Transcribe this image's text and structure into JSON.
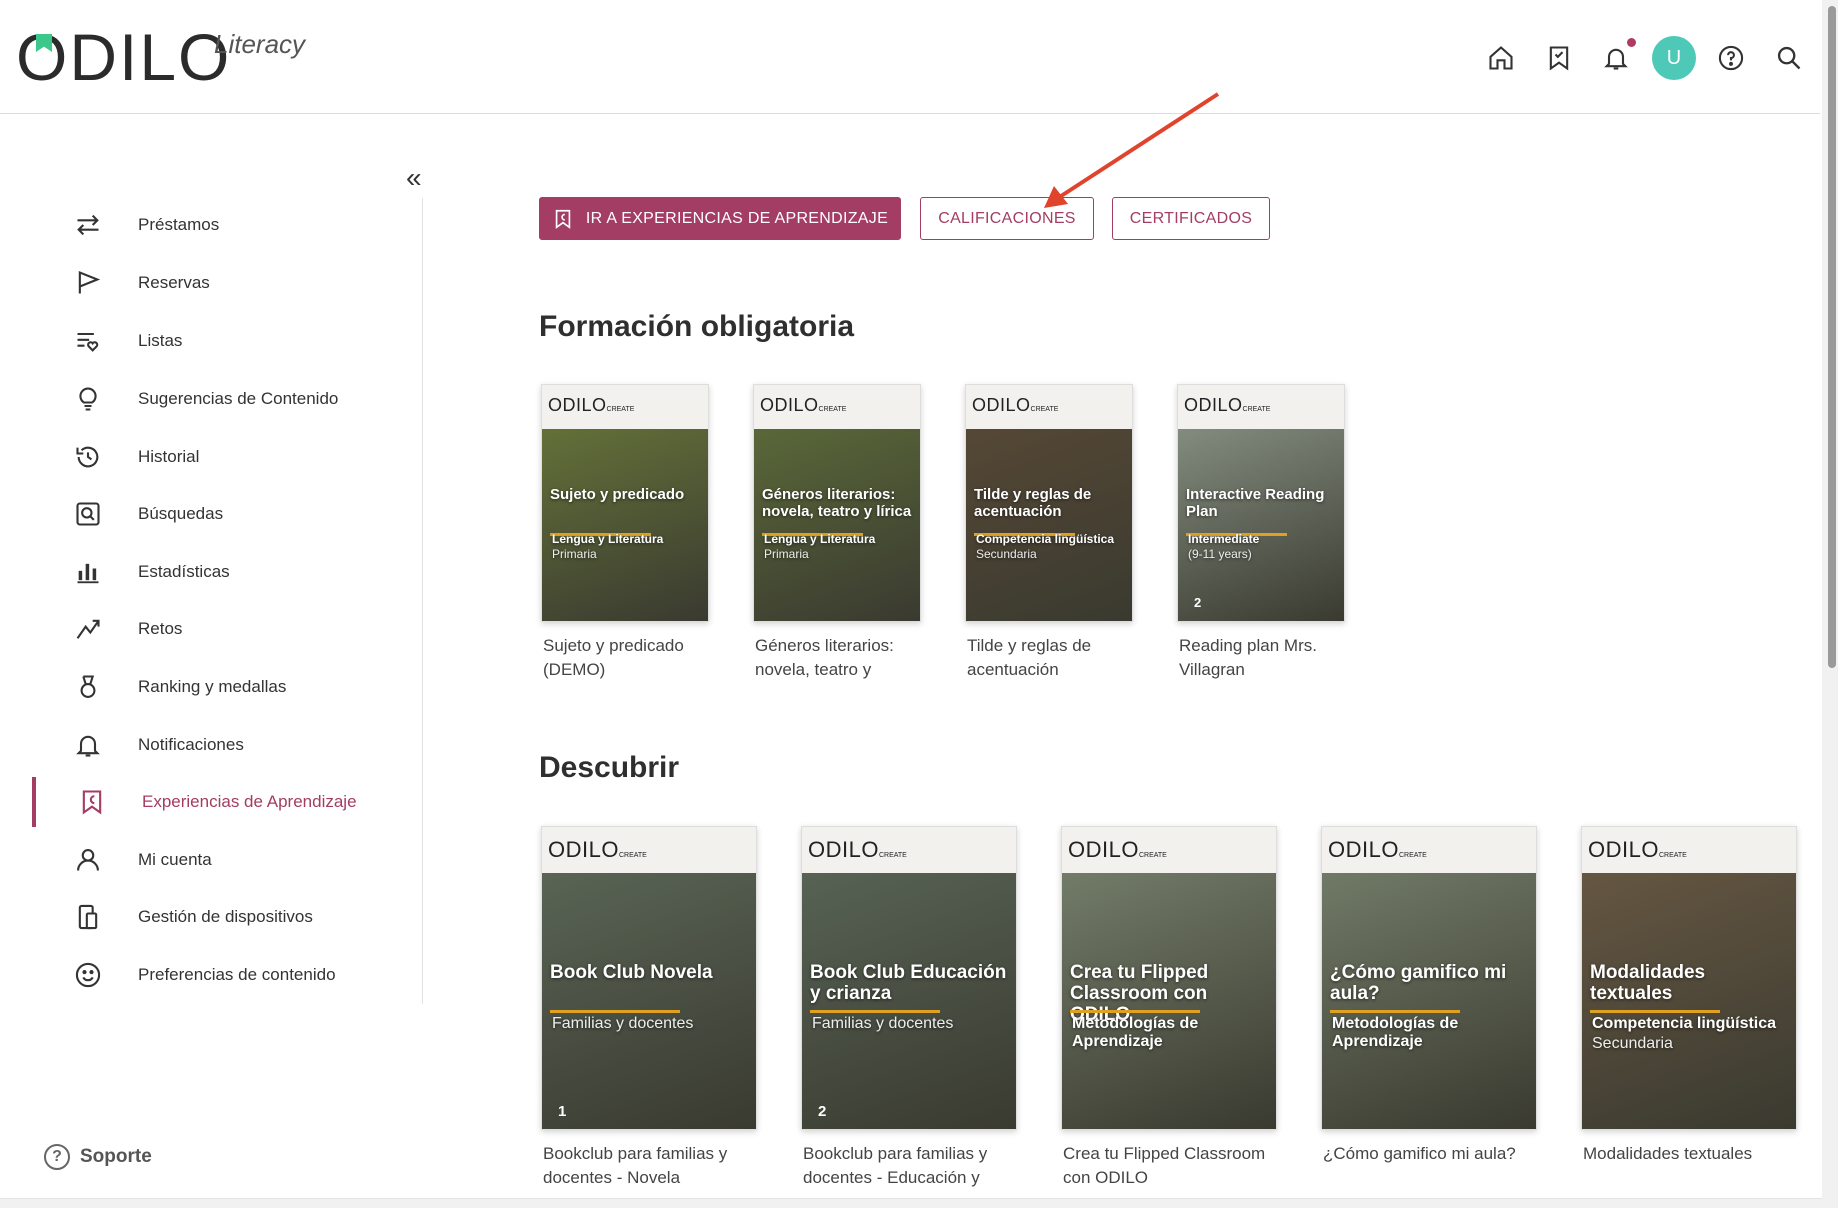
{
  "header": {
    "logo_text": "ODILO",
    "logo_sub": "Literacy",
    "avatar_letter": "U"
  },
  "sidebar": {
    "collapse": "«",
    "items": [
      {
        "label": "Préstamos",
        "icon": "swap-arrows-icon"
      },
      {
        "label": "Reservas",
        "icon": "flag-icon"
      },
      {
        "label": "Listas",
        "icon": "list-heart-icon"
      },
      {
        "label": "Sugerencias de Contenido",
        "icon": "lightbulb-icon"
      },
      {
        "label": "Historial",
        "icon": "history-icon"
      },
      {
        "label": "Búsquedas",
        "icon": "search-box-icon"
      },
      {
        "label": "Estadísticas",
        "icon": "bar-chart-icon"
      },
      {
        "label": "Retos",
        "icon": "challenge-icon"
      },
      {
        "label": "Ranking y medallas",
        "icon": "medal-icon"
      },
      {
        "label": "Notificaciones",
        "icon": "bell-icon"
      },
      {
        "label": "Experiencias de Aprendizaje",
        "icon": "learning-bookmark-icon"
      },
      {
        "label": "Mi cuenta",
        "icon": "user-icon"
      },
      {
        "label": "Gestión de dispositivos",
        "icon": "devices-icon"
      },
      {
        "label": "Preferencias de contenido",
        "icon": "smiley-icon"
      }
    ],
    "active_index": 10,
    "support": "Soporte",
    "support_icon": "?"
  },
  "actions": {
    "go_label": "IR A EXPERIENCIAS DE APRENDIZAJE",
    "grades_label": "CALIFICACIONES",
    "certs_label": "CERTIFICADOS"
  },
  "sections": {
    "mandatory": {
      "title": "Formación obligatoria",
      "cards": [
        {
          "cover_title": "Sujeto y predicado",
          "cover_subject": "Lengua y Literatura",
          "cover_level": "Primaria",
          "cover_num": "",
          "caption1": "Sujeto y predicado",
          "caption2": "(DEMO)",
          "bg": "#6a7a3a"
        },
        {
          "cover_title": "Géneros literarios: novela, teatro y lírica",
          "cover_subject": "Lengua y Literatura",
          "cover_level": "Primaria",
          "cover_num": "",
          "caption1": "Géneros literarios:",
          "caption2": "novela, teatro y",
          "bg": "#5f6f3a"
        },
        {
          "cover_title": "Tilde y reglas de acentuación",
          "cover_subject": "Competencia lingüística",
          "cover_level": "Secundaria",
          "cover_num": "",
          "caption1": "Tilde y reglas de",
          "caption2": "acentuación",
          "bg": "#5a4a36"
        },
        {
          "cover_title": "Interactive Reading Plan",
          "cover_subject": "Intermediate",
          "cover_level": "(9-11 years)",
          "cover_num": "2",
          "caption1": "Reading plan Mrs.",
          "caption2": "Villagran",
          "bg": "#8f9a8c"
        }
      ]
    },
    "discover": {
      "title": "Descubrir",
      "cards": [
        {
          "cover_title": "Book Club Novela",
          "cover_subject": "",
          "cover_level": "Familias y docentes",
          "cover_num": "1",
          "caption1": "Bookclub para familias y",
          "caption2": "docentes - Novela",
          "bg": "#5d6a5a"
        },
        {
          "cover_title": "Book Club Educación y crianza",
          "cover_subject": "",
          "cover_level": "Familias y docentes",
          "cover_num": "2",
          "caption1": "Bookclub para familias y",
          "caption2": "docentes - Educación y",
          "bg": "#5b6859"
        },
        {
          "cover_title": "Crea tu Flipped Classroom con ODILO",
          "cover_subject": "Metodologías de Aprendizaje",
          "cover_level": "",
          "cover_num": "",
          "caption1": "Crea tu Flipped Classroom",
          "caption2": "con ODILO",
          "bg": "#7a8470"
        },
        {
          "cover_title": "¿Cómo gamifico mi aula?",
          "cover_subject": "Metodologías de Aprendizaje",
          "cover_level": "",
          "cover_num": "",
          "caption1": "¿Cómo gamifico mi aula?",
          "caption2": "",
          "bg": "#78826e"
        },
        {
          "cover_title": "Modalidades textuales",
          "cover_subject": "Competencia lingüística",
          "cover_level": "Secundaria",
          "cover_num": "",
          "caption1": "Modalidades textuales",
          "caption2": "",
          "bg": "#6b5a44"
        }
      ]
    }
  },
  "colors": {
    "accent": "#a33d63",
    "avatar": "#4ec9b8",
    "logo_mark": "#3cc88b",
    "arrow": "#e0442c"
  }
}
